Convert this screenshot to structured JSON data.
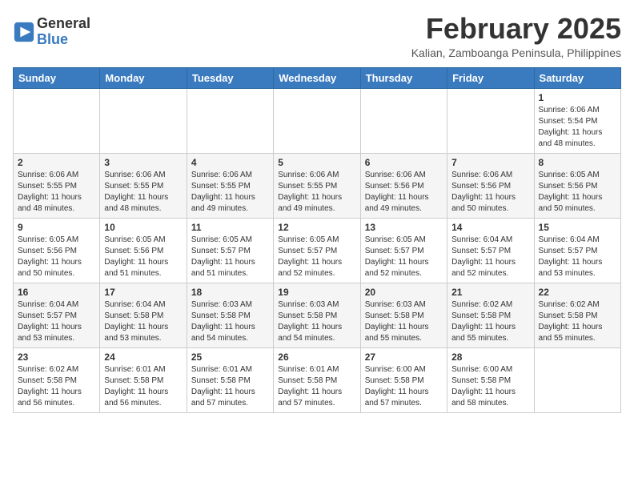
{
  "header": {
    "logo_general": "General",
    "logo_blue": "Blue",
    "month_year": "February 2025",
    "location": "Kalian, Zamboanga Peninsula, Philippines"
  },
  "weekdays": [
    "Sunday",
    "Monday",
    "Tuesday",
    "Wednesday",
    "Thursday",
    "Friday",
    "Saturday"
  ],
  "weeks": [
    [
      {
        "day": "",
        "info": ""
      },
      {
        "day": "",
        "info": ""
      },
      {
        "day": "",
        "info": ""
      },
      {
        "day": "",
        "info": ""
      },
      {
        "day": "",
        "info": ""
      },
      {
        "day": "",
        "info": ""
      },
      {
        "day": "1",
        "info": "Sunrise: 6:06 AM\nSunset: 5:54 PM\nDaylight: 11 hours\nand 48 minutes."
      }
    ],
    [
      {
        "day": "2",
        "info": "Sunrise: 6:06 AM\nSunset: 5:55 PM\nDaylight: 11 hours\nand 48 minutes."
      },
      {
        "day": "3",
        "info": "Sunrise: 6:06 AM\nSunset: 5:55 PM\nDaylight: 11 hours\nand 48 minutes."
      },
      {
        "day": "4",
        "info": "Sunrise: 6:06 AM\nSunset: 5:55 PM\nDaylight: 11 hours\nand 49 minutes."
      },
      {
        "day": "5",
        "info": "Sunrise: 6:06 AM\nSunset: 5:55 PM\nDaylight: 11 hours\nand 49 minutes."
      },
      {
        "day": "6",
        "info": "Sunrise: 6:06 AM\nSunset: 5:56 PM\nDaylight: 11 hours\nand 49 minutes."
      },
      {
        "day": "7",
        "info": "Sunrise: 6:06 AM\nSunset: 5:56 PM\nDaylight: 11 hours\nand 50 minutes."
      },
      {
        "day": "8",
        "info": "Sunrise: 6:05 AM\nSunset: 5:56 PM\nDaylight: 11 hours\nand 50 minutes."
      }
    ],
    [
      {
        "day": "9",
        "info": "Sunrise: 6:05 AM\nSunset: 5:56 PM\nDaylight: 11 hours\nand 50 minutes."
      },
      {
        "day": "10",
        "info": "Sunrise: 6:05 AM\nSunset: 5:56 PM\nDaylight: 11 hours\nand 51 minutes."
      },
      {
        "day": "11",
        "info": "Sunrise: 6:05 AM\nSunset: 5:57 PM\nDaylight: 11 hours\nand 51 minutes."
      },
      {
        "day": "12",
        "info": "Sunrise: 6:05 AM\nSunset: 5:57 PM\nDaylight: 11 hours\nand 52 minutes."
      },
      {
        "day": "13",
        "info": "Sunrise: 6:05 AM\nSunset: 5:57 PM\nDaylight: 11 hours\nand 52 minutes."
      },
      {
        "day": "14",
        "info": "Sunrise: 6:04 AM\nSunset: 5:57 PM\nDaylight: 11 hours\nand 52 minutes."
      },
      {
        "day": "15",
        "info": "Sunrise: 6:04 AM\nSunset: 5:57 PM\nDaylight: 11 hours\nand 53 minutes."
      }
    ],
    [
      {
        "day": "16",
        "info": "Sunrise: 6:04 AM\nSunset: 5:57 PM\nDaylight: 11 hours\nand 53 minutes."
      },
      {
        "day": "17",
        "info": "Sunrise: 6:04 AM\nSunset: 5:58 PM\nDaylight: 11 hours\nand 53 minutes."
      },
      {
        "day": "18",
        "info": "Sunrise: 6:03 AM\nSunset: 5:58 PM\nDaylight: 11 hours\nand 54 minutes."
      },
      {
        "day": "19",
        "info": "Sunrise: 6:03 AM\nSunset: 5:58 PM\nDaylight: 11 hours\nand 54 minutes."
      },
      {
        "day": "20",
        "info": "Sunrise: 6:03 AM\nSunset: 5:58 PM\nDaylight: 11 hours\nand 55 minutes."
      },
      {
        "day": "21",
        "info": "Sunrise: 6:02 AM\nSunset: 5:58 PM\nDaylight: 11 hours\nand 55 minutes."
      },
      {
        "day": "22",
        "info": "Sunrise: 6:02 AM\nSunset: 5:58 PM\nDaylight: 11 hours\nand 55 minutes."
      }
    ],
    [
      {
        "day": "23",
        "info": "Sunrise: 6:02 AM\nSunset: 5:58 PM\nDaylight: 11 hours\nand 56 minutes."
      },
      {
        "day": "24",
        "info": "Sunrise: 6:01 AM\nSunset: 5:58 PM\nDaylight: 11 hours\nand 56 minutes."
      },
      {
        "day": "25",
        "info": "Sunrise: 6:01 AM\nSunset: 5:58 PM\nDaylight: 11 hours\nand 57 minutes."
      },
      {
        "day": "26",
        "info": "Sunrise: 6:01 AM\nSunset: 5:58 PM\nDaylight: 11 hours\nand 57 minutes."
      },
      {
        "day": "27",
        "info": "Sunrise: 6:00 AM\nSunset: 5:58 PM\nDaylight: 11 hours\nand 57 minutes."
      },
      {
        "day": "28",
        "info": "Sunrise: 6:00 AM\nSunset: 5:58 PM\nDaylight: 11 hours\nand 58 minutes."
      },
      {
        "day": "",
        "info": ""
      }
    ]
  ]
}
